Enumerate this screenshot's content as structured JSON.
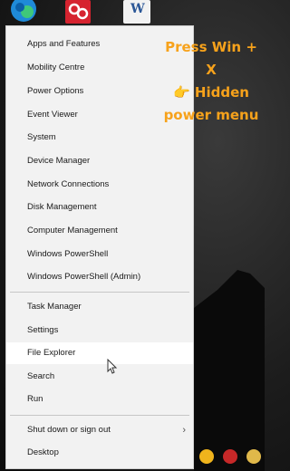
{
  "menu": {
    "group1": [
      "Apps and Features",
      "Mobility Centre",
      "Power Options",
      "Event Viewer",
      "System",
      "Device Manager",
      "Network Connections",
      "Disk Management",
      "Computer Management",
      "Windows PowerShell",
      "Windows PowerShell (Admin)"
    ],
    "group2": [
      "Task Manager",
      "Settings",
      "File Explorer",
      "Search",
      "Run"
    ],
    "group3": [
      "Shut down or sign out",
      "Desktop"
    ]
  },
  "annotation": {
    "line1": "Press Win + X",
    "line2": "👉 Hidden",
    "line3": "power menu"
  },
  "icons": {
    "edge": "edge-browser-icon",
    "app": "red-app-icon",
    "word": "word-document-icon"
  },
  "colors": {
    "accent": "#f7a21b",
    "menu_bg": "#f2f2f2",
    "hover_bg": "#ffffff"
  }
}
